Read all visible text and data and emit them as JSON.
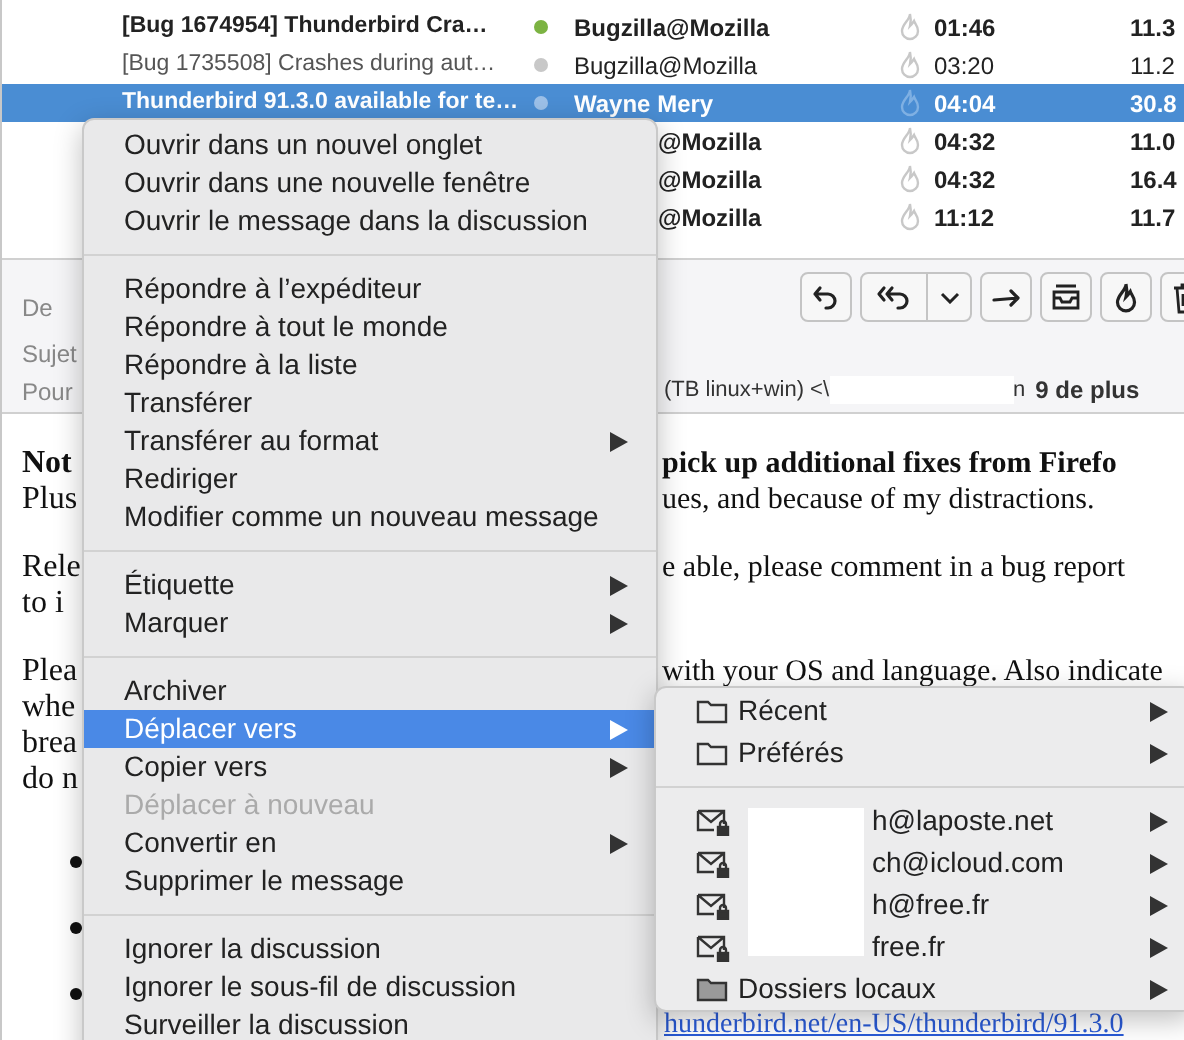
{
  "message_list": {
    "rows": [
      {
        "subject": "[Bug 1674954] Thunderbird Cra…",
        "unread": true,
        "selected": false,
        "color": "#7cb342",
        "sender": "Bugzilla@Mozilla",
        "time": "01:46",
        "size": "11.3"
      },
      {
        "subject": "[Bug 1735508] Crashes during aut…",
        "unread": false,
        "selected": false,
        "color": "#c8c8c8",
        "sender": "Bugzilla@Mozilla",
        "time": "03:20",
        "size": "11.2"
      },
      {
        "subject": "Thunderbird 91.3.0 available for te…",
        "unread": true,
        "selected": true,
        "color": "#9cc0e8",
        "sender": "Wayne Mery",
        "time": "04:04",
        "size": "30.8"
      },
      {
        "unread": true,
        "selected": false,
        "sender": "@Mozilla",
        "covered": true,
        "time": "04:32",
        "size": "11.0"
      },
      {
        "unread": true,
        "selected": false,
        "sender": "@Mozilla",
        "covered": true,
        "time": "04:32",
        "size": "16.4"
      },
      {
        "unread": true,
        "selected": false,
        "sender": "@Mozilla",
        "covered": true,
        "time": "11:12",
        "size": "11.7"
      }
    ]
  },
  "header": {
    "labels": [
      "De",
      "Sujet",
      "Pour"
    ],
    "to_start": "(TB linux+win) <\\",
    "to_end": "n",
    "more": "9 de plus",
    "toolbar": [
      {
        "kind": "reply"
      },
      {
        "kind": "reply_all"
      },
      {
        "kind": "forward"
      },
      {
        "kind": "archive"
      },
      {
        "kind": "junk"
      },
      {
        "kind": "delete"
      }
    ]
  },
  "body": {
    "paragraphs": [
      [
        {
          "left": "Not",
          "right": "pick up additional fixes from Firefo",
          "bold": true
        },
        {
          "left": "Plus",
          "right": "ues, and because of my distractions.",
          "bold": false
        }
      ],
      [
        {
          "left": "Rele",
          "right": "e able, please comment in a bug report",
          "bold": false
        },
        {
          "left": "to i",
          "bold": false
        }
      ],
      [
        {
          "left": "Plea",
          "right": "with your OS and language. Also indicate",
          "bold": false
        },
        {
          "left": "whe",
          "bold": false
        },
        {
          "left": "brea",
          "bold": false
        },
        {
          "left": "do n",
          "bold": false
        }
      ]
    ],
    "link": "hunderbird.net/en-US/thunderbird/91.3.0"
  },
  "context_menu": {
    "groups": [
      [
        {
          "label": "Ouvrir dans un nouvel onglet",
          "submenu": false,
          "selected": false,
          "disabled": false
        },
        {
          "label": "Ouvrir dans une nouvelle fenêtre",
          "submenu": false,
          "selected": false,
          "disabled": false
        },
        {
          "label": "Ouvrir le message dans la discussion",
          "submenu": false,
          "selected": false,
          "disabled": false
        }
      ],
      [
        {
          "label": "Répondre à l’expéditeur",
          "submenu": false,
          "selected": false,
          "disabled": false
        },
        {
          "label": "Répondre à tout le monde",
          "submenu": false,
          "selected": false,
          "disabled": false
        },
        {
          "label": "Répondre à la liste",
          "submenu": false,
          "selected": false,
          "disabled": false
        },
        {
          "label": "Transférer",
          "submenu": false,
          "selected": false,
          "disabled": false
        },
        {
          "label": "Transférer au format",
          "submenu": true,
          "selected": false,
          "disabled": false
        },
        {
          "label": "Rediriger",
          "submenu": false,
          "selected": false,
          "disabled": false
        },
        {
          "label": "Modifier comme un nouveau message",
          "submenu": false,
          "selected": false,
          "disabled": false
        }
      ],
      [
        {
          "label": "Étiquette",
          "submenu": true,
          "selected": false,
          "disabled": false
        },
        {
          "label": "Marquer",
          "submenu": true,
          "selected": false,
          "disabled": false
        }
      ],
      [
        {
          "label": "Archiver",
          "submenu": false,
          "selected": false,
          "disabled": false
        },
        {
          "label": "Déplacer vers",
          "submenu": true,
          "selected": true,
          "disabled": false
        },
        {
          "label": "Copier vers",
          "submenu": true,
          "selected": false,
          "disabled": false
        },
        {
          "label": "Déplacer à nouveau",
          "submenu": false,
          "selected": false,
          "disabled": true
        },
        {
          "label": "Convertir en",
          "submenu": true,
          "selected": false,
          "disabled": false
        },
        {
          "label": "Supprimer le message",
          "submenu": false,
          "selected": false,
          "disabled": false
        }
      ],
      [
        {
          "label": "Ignorer la discussion",
          "submenu": false,
          "selected": false,
          "disabled": false
        },
        {
          "label": "Ignorer le sous-fil de discussion",
          "submenu": false,
          "selected": false,
          "disabled": false
        },
        {
          "label": "Surveiller la discussion",
          "submenu": false,
          "selected": false,
          "disabled": false
        }
      ]
    ]
  },
  "submenu": {
    "groups": [
      [
        {
          "kind": "folder",
          "label": "Récent"
        },
        {
          "kind": "folder",
          "label": "Préférés"
        }
      ],
      [
        {
          "kind": "account",
          "label": "h@laposte.net"
        },
        {
          "kind": "account",
          "label": "ch@icloud.com"
        },
        {
          "kind": "account",
          "label": "h@free.fr"
        },
        {
          "kind": "account",
          "label": "free.fr"
        },
        {
          "kind": "local",
          "label": "Dossiers locaux"
        }
      ]
    ]
  }
}
